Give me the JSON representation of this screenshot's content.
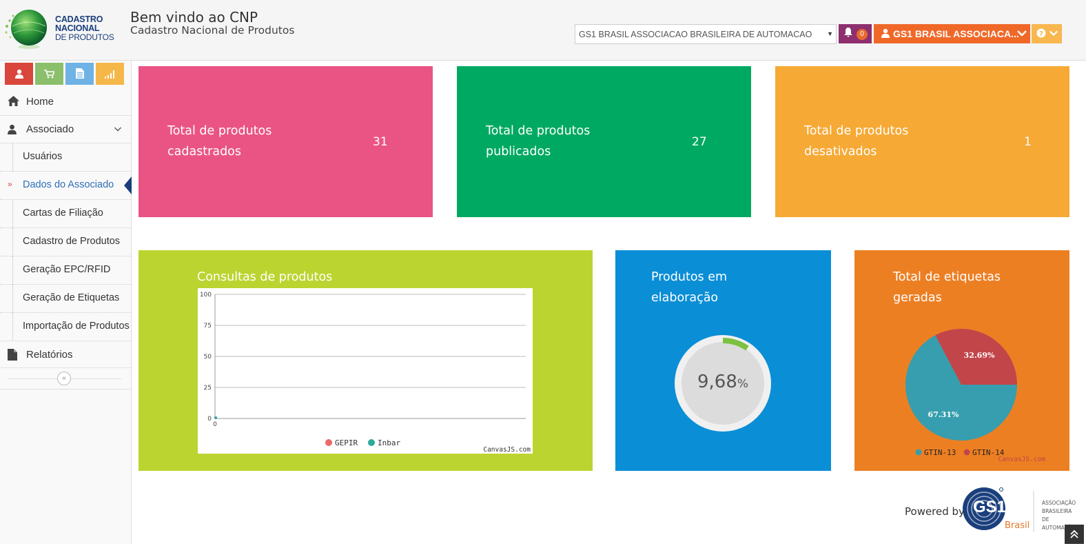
{
  "header": {
    "logo": {
      "line1": "CADASTRO",
      "line2": "NACIONAL",
      "line3": "DE PRODUTOS"
    },
    "welcome": "Bem vindo ao CNP",
    "subtitle": "Cadastro Nacional de Produtos",
    "org_select_value": "GS1 BRASIL ASSOCIACAO BRASILEIRA DE AUTOMACAO",
    "notifications_count": "0",
    "user_name": "GS1 BRASIL ASSOCIACA...",
    "help_label": "?"
  },
  "sidebar": {
    "shortcuts": [
      {
        "icon": "user-icon",
        "color": "#d9463b"
      },
      {
        "icon": "cart-icon",
        "color": "#8bbf6b"
      },
      {
        "icon": "document-icon",
        "color": "#6fb2e5"
      },
      {
        "icon": "signal-icon",
        "color": "#f6b749"
      }
    ],
    "items": [
      {
        "label": "Home",
        "icon": "home-icon"
      },
      {
        "label": "Associado",
        "icon": "user-icon"
      },
      {
        "label": "Relatórios",
        "icon": "file-icon"
      }
    ],
    "subitems": [
      {
        "label": "Usuários"
      },
      {
        "label": "Dados do Associado"
      },
      {
        "label": "Cartas de Filiação"
      },
      {
        "label": "Cadastro de Produtos"
      },
      {
        "label": "Geração EPC/RFID"
      },
      {
        "label": "Geração de Etiquetas"
      },
      {
        "label": "Importação de Produtos"
      }
    ]
  },
  "tiles": {
    "cadastrados": {
      "line1": "Total de produtos",
      "line2": "cadastrados",
      "value": "31",
      "color": "#ea5484"
    },
    "publicados": {
      "line1": "Total de produtos",
      "line2": "publicados",
      "value": "27",
      "color": "#00a961"
    },
    "desativados": {
      "line1": "Total de produtos",
      "line2": "desativados",
      "value": "1",
      "color": "#f6a935"
    },
    "consultas": {
      "title": "Consultas de produtos",
      "color": "#bcd42f"
    },
    "elaboracao": {
      "line1": "Produtos em",
      "line2": "elaboração",
      "value": "9,68",
      "unit": "%",
      "color": "#0a8ed6"
    },
    "etiquetas": {
      "line1": "Total de etiquetas",
      "line2": "geradas",
      "color": "#ed7f23"
    }
  },
  "chart_data": [
    {
      "type": "line",
      "title": "Consultas de produtos",
      "x": [
        0
      ],
      "series": [
        {
          "name": "GEPIR",
          "values": [
            0
          ],
          "color": "#e86a6a"
        },
        {
          "name": "Inbar",
          "values": [
            0
          ],
          "color": "#2eaa9b"
        }
      ],
      "ylim": [
        0,
        100
      ],
      "yticks": [
        "100",
        "75",
        "50",
        "25",
        "0"
      ],
      "xticks": [
        "0"
      ],
      "credit": "CanvasJS.com"
    },
    {
      "type": "pie",
      "title": "Total de etiquetas geradas",
      "slices": [
        {
          "name": "GTIN-13",
          "value": 67.31,
          "label": "67.31%",
          "color": "#369eae"
        },
        {
          "name": "GTIN-14",
          "value": 32.69,
          "label": "32.69%",
          "color": "#c2454a"
        }
      ],
      "credit": "CanvasJS.com"
    }
  ],
  "progress": {
    "value": 9.68
  },
  "footer": {
    "powered_by": "Powered by",
    "brand": "GS1",
    "brand_sub": "Brasil",
    "org_line1": "ASSOCIAÇÃO",
    "org_line2": "BRASILEIRA",
    "org_line3": "DE AUTOMAÇÃO"
  }
}
